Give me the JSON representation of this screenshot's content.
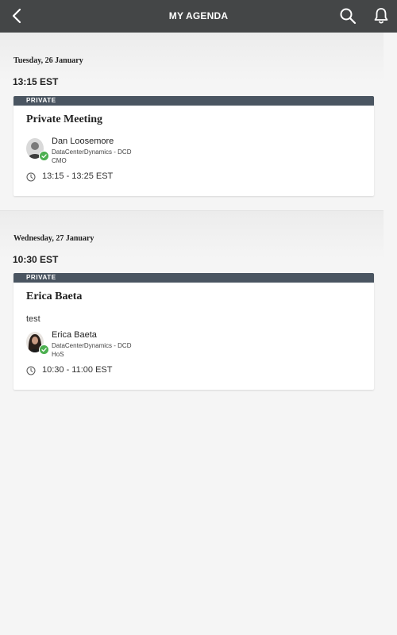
{
  "header": {
    "title": "MY AGENDA",
    "icons": [
      "back-arrow-icon",
      "search-icon",
      "bell-icon"
    ]
  },
  "days": [
    {
      "date": "Tuesday, 26 January",
      "time": "13:15 EST",
      "meeting": {
        "badge": "PRIVATE",
        "title": "Private Meeting",
        "description": "",
        "person": {
          "name": "Dan Loosemore",
          "company": "DataCenterDynamics - DCD",
          "role": "CMO"
        },
        "time_range": "13:15 - 13:25 EST"
      }
    },
    {
      "date": "Wednesday, 27 January",
      "time": "10:30 EST",
      "meeting": {
        "badge": "PRIVATE",
        "title": "Erica Baeta",
        "description": "test",
        "person": {
          "name": "Erica Baeta",
          "company": "DataCenterDynamics - DCD",
          "role": "HoS"
        },
        "time_range": "10:30 - 11:00 EST"
      }
    }
  ],
  "colors": {
    "topbar": "#444647",
    "badge": "#4a5561",
    "check": "#4caf50",
    "background": "#f5f5f5"
  }
}
